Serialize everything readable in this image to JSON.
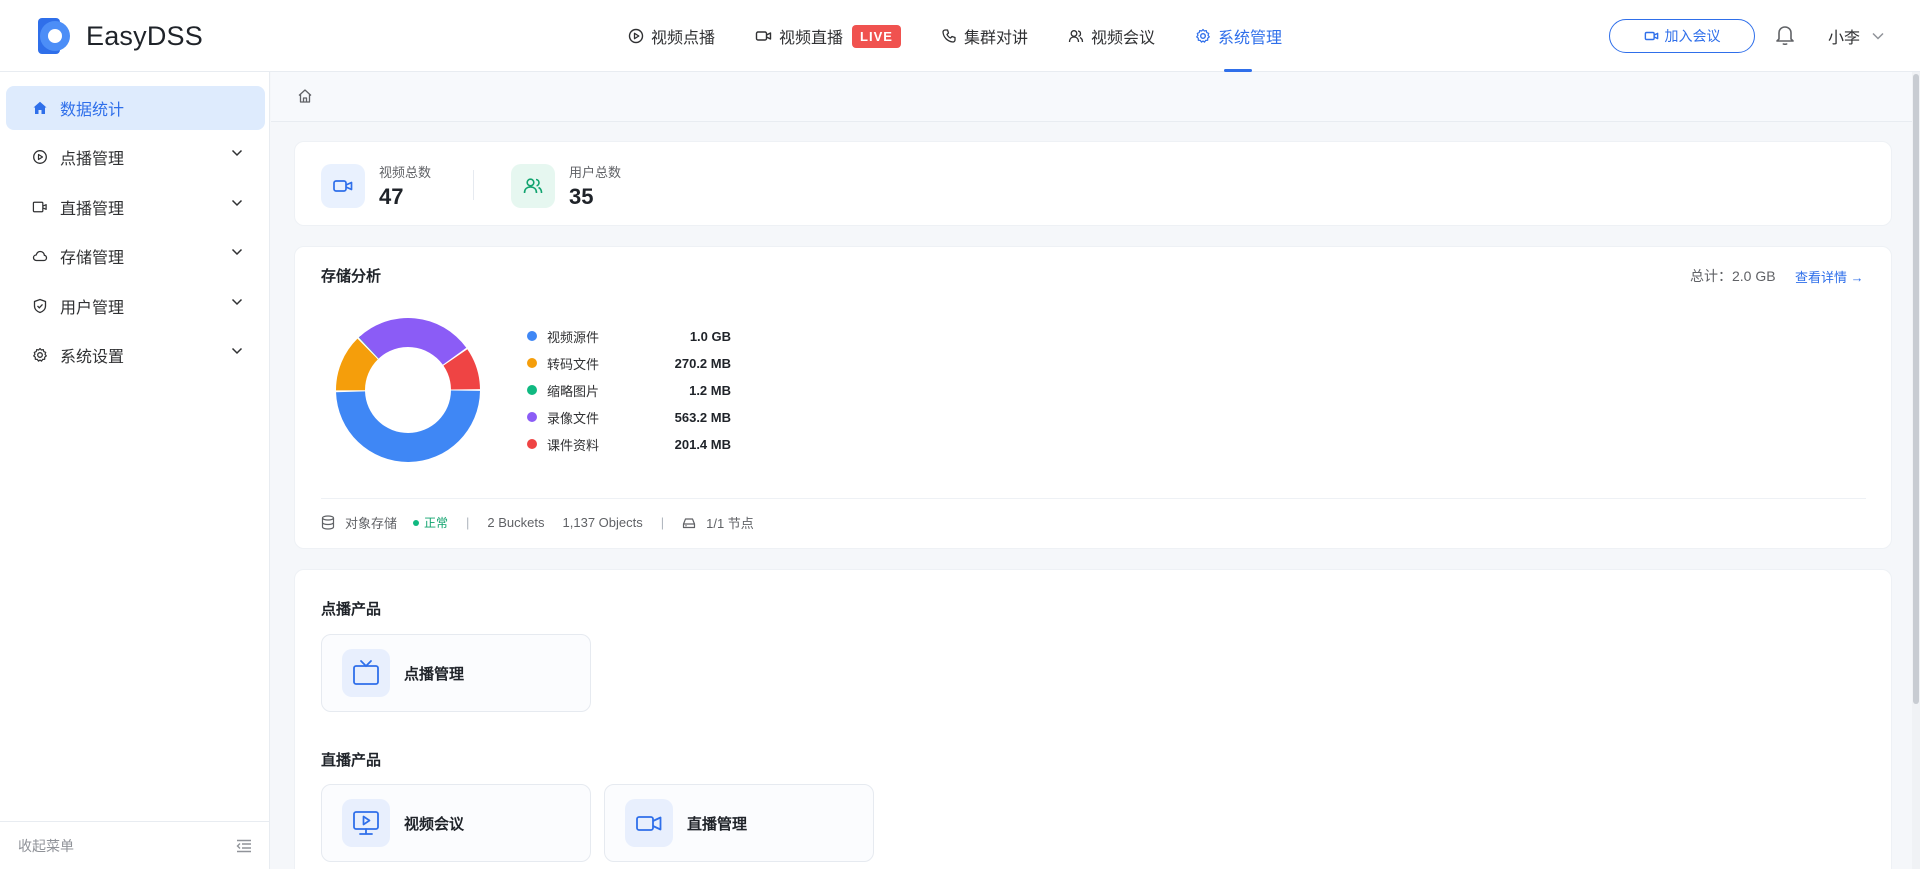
{
  "app": {
    "name": "EasyDSS",
    "accent": "#2f6fea"
  },
  "nav": {
    "items": [
      {
        "label": "视频点播",
        "icon": "play-circle-icon"
      },
      {
        "label": "视频直播",
        "icon": "video-camera-icon",
        "badge": "LIVE"
      },
      {
        "label": "集群对讲",
        "icon": "phone-icon"
      },
      {
        "label": "视频会议",
        "icon": "users-icon"
      },
      {
        "label": "系统管理",
        "icon": "gear-icon",
        "active": true
      }
    ],
    "join_label": "加入会议",
    "user_name": "小李"
  },
  "sidebar": {
    "items": [
      {
        "label": "数据统计",
        "icon": "home-icon",
        "active": true
      },
      {
        "label": "点播管理",
        "icon": "play-circle-icon"
      },
      {
        "label": "直播管理",
        "icon": "video-camera-icon"
      },
      {
        "label": "存储管理",
        "icon": "cloud-icon"
      },
      {
        "label": "用户管理",
        "icon": "shield-icon"
      },
      {
        "label": "系统设置",
        "icon": "gear-icon"
      }
    ],
    "collapse_label": "收起菜单"
  },
  "stats": {
    "videos": {
      "label": "视频总数",
      "value": "47"
    },
    "users": {
      "label": "用户总数",
      "value": "35"
    }
  },
  "storage": {
    "title": "存储分析",
    "total": "总计：2.0 GB",
    "details_link": "查看详情 →",
    "footer": {
      "label": "对象存储",
      "status": "正常",
      "buckets": "2 Buckets",
      "objects": "1,137 Objects",
      "nodes": "1/1 节点"
    }
  },
  "chart_data": {
    "type": "pie",
    "categories": [
      "视频源件",
      "转码文件",
      "缩略图片",
      "录像文件",
      "课件资料"
    ],
    "value_labels": [
      "1.0 GB",
      "270.2 MB",
      "1.2 MB",
      "563.2 MB",
      "201.4 MB"
    ],
    "values": [
      1024,
      270.2,
      1.2,
      563.2,
      201.4
    ],
    "colors": [
      "#3f87f5",
      "#f59e0b",
      "#10b981",
      "#8b5cf6",
      "#ef4444"
    ],
    "donut": true
  },
  "products": {
    "vod_title": "点播产品",
    "vod_items": [
      {
        "label": "点播管理",
        "icon": "tv-icon"
      }
    ],
    "live_title": "直播产品",
    "live_items": [
      {
        "label": "视频会议",
        "icon": "monitor-play-icon"
      },
      {
        "label": "直播管理",
        "icon": "video-camera-icon"
      }
    ]
  }
}
